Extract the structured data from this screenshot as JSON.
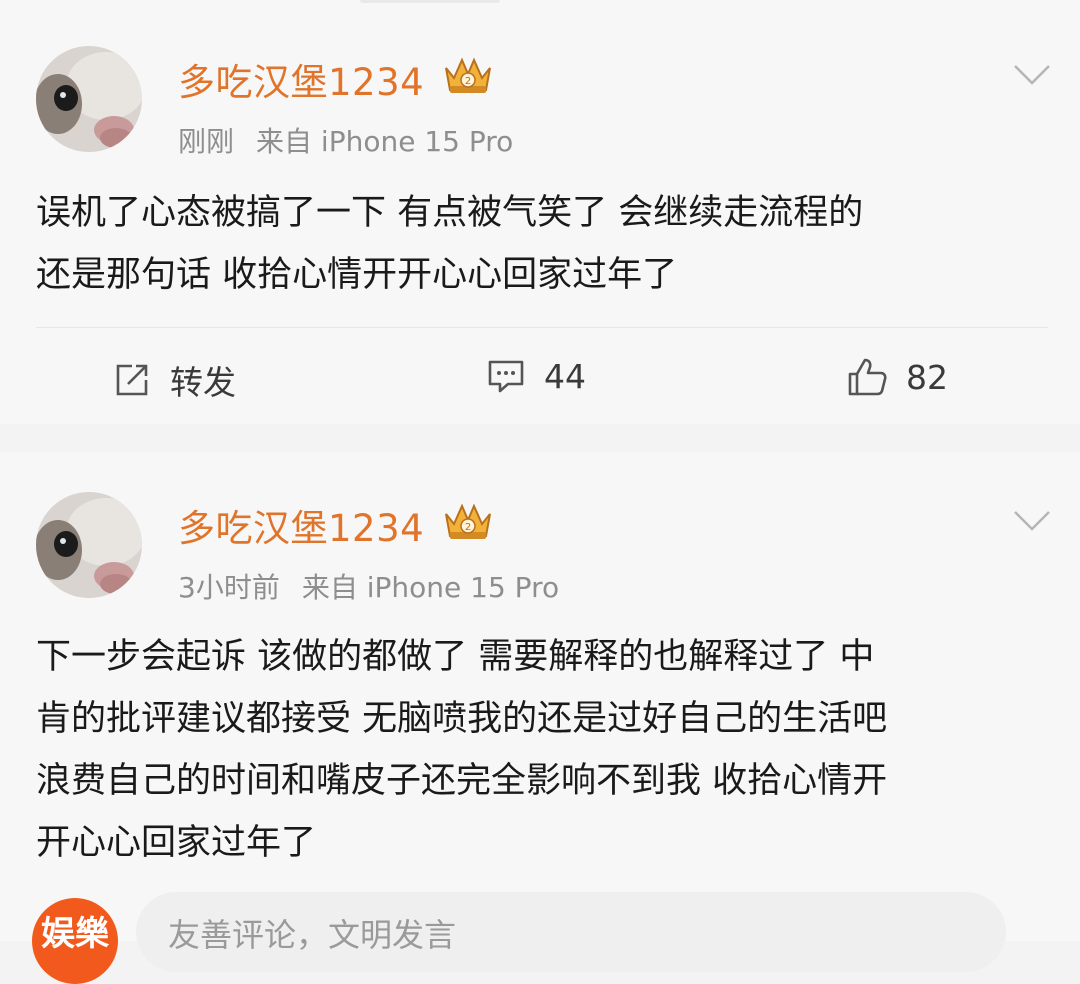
{
  "posts": [
    {
      "username": "多吃汉堡1234",
      "time": "刚刚",
      "source": "来自 iPhone 15 Pro",
      "text": "误机了心态被搞了一下 有点被气笑了 会继续走流程的\n还是那句话 收拾心情开开心心回家过年了",
      "actions": {
        "repost_label": "转发",
        "comments": "44",
        "likes": "82"
      }
    },
    {
      "username": "多吃汉堡1234",
      "time": "3小时前",
      "source": "来自 iPhone 15 Pro",
      "text": "下一步会起诉 该做的都做了 需要解释的也解释过了 中\n肯的批评建议都接受 无脑喷我的还是过好自己的生活吧\n浪费自己的时间和嘴皮子还完全影响不到我 收拾心情开\n开心心回家过年了"
    }
  ],
  "comment_box": {
    "badge": "娱樂",
    "placeholder": "友善评论，文明发言"
  },
  "icons": {
    "avatar": "cat-avatar",
    "crown": "crown-vip-icon",
    "menu": "chevron-down-icon",
    "repost": "share-icon",
    "comment": "comment-icon",
    "like": "thumbs-up-icon"
  },
  "colors": {
    "username": "#e0742a",
    "meta": "#8e8e8e",
    "badge": "#f25a1d"
  }
}
